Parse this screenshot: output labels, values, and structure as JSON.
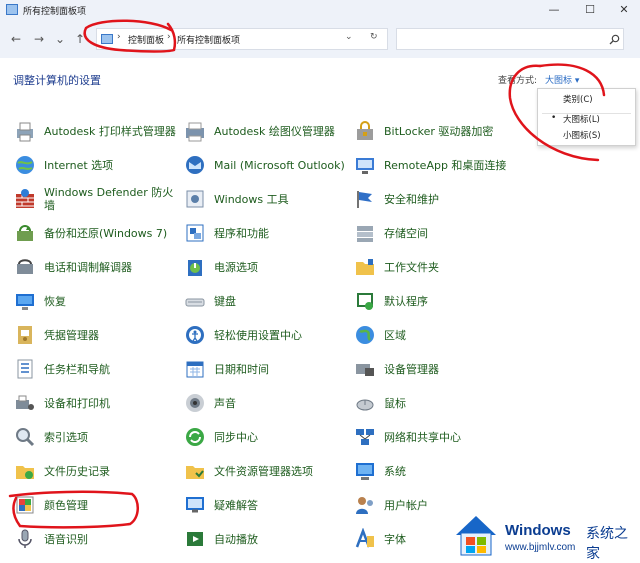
{
  "window": {
    "title": "所有控制面板项",
    "minimize": "—",
    "maximize": "☐",
    "close": "✕"
  },
  "nav": {
    "back": "←",
    "forward": "→",
    "recent": "⌄",
    "up": "↑",
    "dropdown": "⌄",
    "refresh": "↻"
  },
  "breadcrumb": {
    "items": [
      "控制面板",
      "所有控制面板项"
    ],
    "separator": "›"
  },
  "search": {
    "placeholder": ""
  },
  "heading": "调整计算机的设置",
  "view_by": {
    "label": "查看方式:",
    "value": "大图标 ▾",
    "options": [
      {
        "label": "类别(C)",
        "selected": false
      },
      {
        "label": "大图标(L)",
        "selected": true
      },
      {
        "label": "小图标(S)",
        "selected": false
      }
    ]
  },
  "items": [
    {
      "label": "Autodesk 打印样式管理器",
      "icon": "printer-icon"
    },
    {
      "label": "Autodesk 绘图仪管理器",
      "icon": "plotter-icon"
    },
    {
      "label": "BitLocker 驱动器加密",
      "icon": "bitlocker-icon"
    },
    {
      "label": "Internet 选项",
      "icon": "internet-icon"
    },
    {
      "label": "Mail (Microsoft Outlook)",
      "icon": "mail-icon"
    },
    {
      "label": "RemoteApp 和桌面连接",
      "icon": "remoteapp-icon"
    },
    {
      "label": "Windows Defender 防火墙",
      "icon": "firewall-icon"
    },
    {
      "label": "Windows 工具",
      "icon": "windows-tools-icon"
    },
    {
      "label": "安全和维护",
      "icon": "security-flag-icon"
    },
    {
      "label": "备份和还原(Windows 7)",
      "icon": "backup-icon"
    },
    {
      "label": "程序和功能",
      "icon": "programs-icon"
    },
    {
      "label": "存储空间",
      "icon": "storage-icon"
    },
    {
      "label": "电话和调制解调器",
      "icon": "phone-modem-icon"
    },
    {
      "label": "电源选项",
      "icon": "power-icon"
    },
    {
      "label": "工作文件夹",
      "icon": "work-folders-icon"
    },
    {
      "label": "恢复",
      "icon": "recovery-icon"
    },
    {
      "label": "键盘",
      "icon": "keyboard-icon"
    },
    {
      "label": "默认程序",
      "icon": "default-programs-icon"
    },
    {
      "label": "凭据管理器",
      "icon": "credential-icon"
    },
    {
      "label": "轻松使用设置中心",
      "icon": "ease-of-access-icon"
    },
    {
      "label": "区域",
      "icon": "region-icon"
    },
    {
      "label": "任务栏和导航",
      "icon": "taskbar-icon"
    },
    {
      "label": "日期和时间",
      "icon": "calendar-icon"
    },
    {
      "label": "设备管理器",
      "icon": "device-manager-icon"
    },
    {
      "label": "设备和打印机",
      "icon": "devices-printers-icon"
    },
    {
      "label": "声音",
      "icon": "sound-icon"
    },
    {
      "label": "鼠标",
      "icon": "mouse-icon"
    },
    {
      "label": "索引选项",
      "icon": "indexing-icon"
    },
    {
      "label": "同步中心",
      "icon": "sync-icon"
    },
    {
      "label": "网络和共享中心",
      "icon": "network-icon"
    },
    {
      "label": "文件历史记录",
      "icon": "file-history-icon"
    },
    {
      "label": "文件资源管理器选项",
      "icon": "explorer-options-icon"
    },
    {
      "label": "系统",
      "icon": "system-icon"
    },
    {
      "label": "颜色管理",
      "icon": "color-management-icon"
    },
    {
      "label": "疑难解答",
      "icon": "troubleshooting-icon"
    },
    {
      "label": "用户帐户",
      "icon": "user-accounts-icon"
    },
    {
      "label": "语音识别",
      "icon": "microphone-icon"
    },
    {
      "label": "自动播放",
      "icon": "autoplay-icon"
    },
    {
      "label": "字体",
      "icon": "fonts-icon"
    }
  ],
  "watermark": {
    "brand": "Windows",
    "cn": "系统之家",
    "url": "www.bjjmlv.com"
  },
  "colors": {
    "link_green": "#1e5c1e",
    "heading_blue": "#1e3d8f",
    "annotation_red": "#e0141b",
    "chrome_bg": "#eef2f9"
  }
}
